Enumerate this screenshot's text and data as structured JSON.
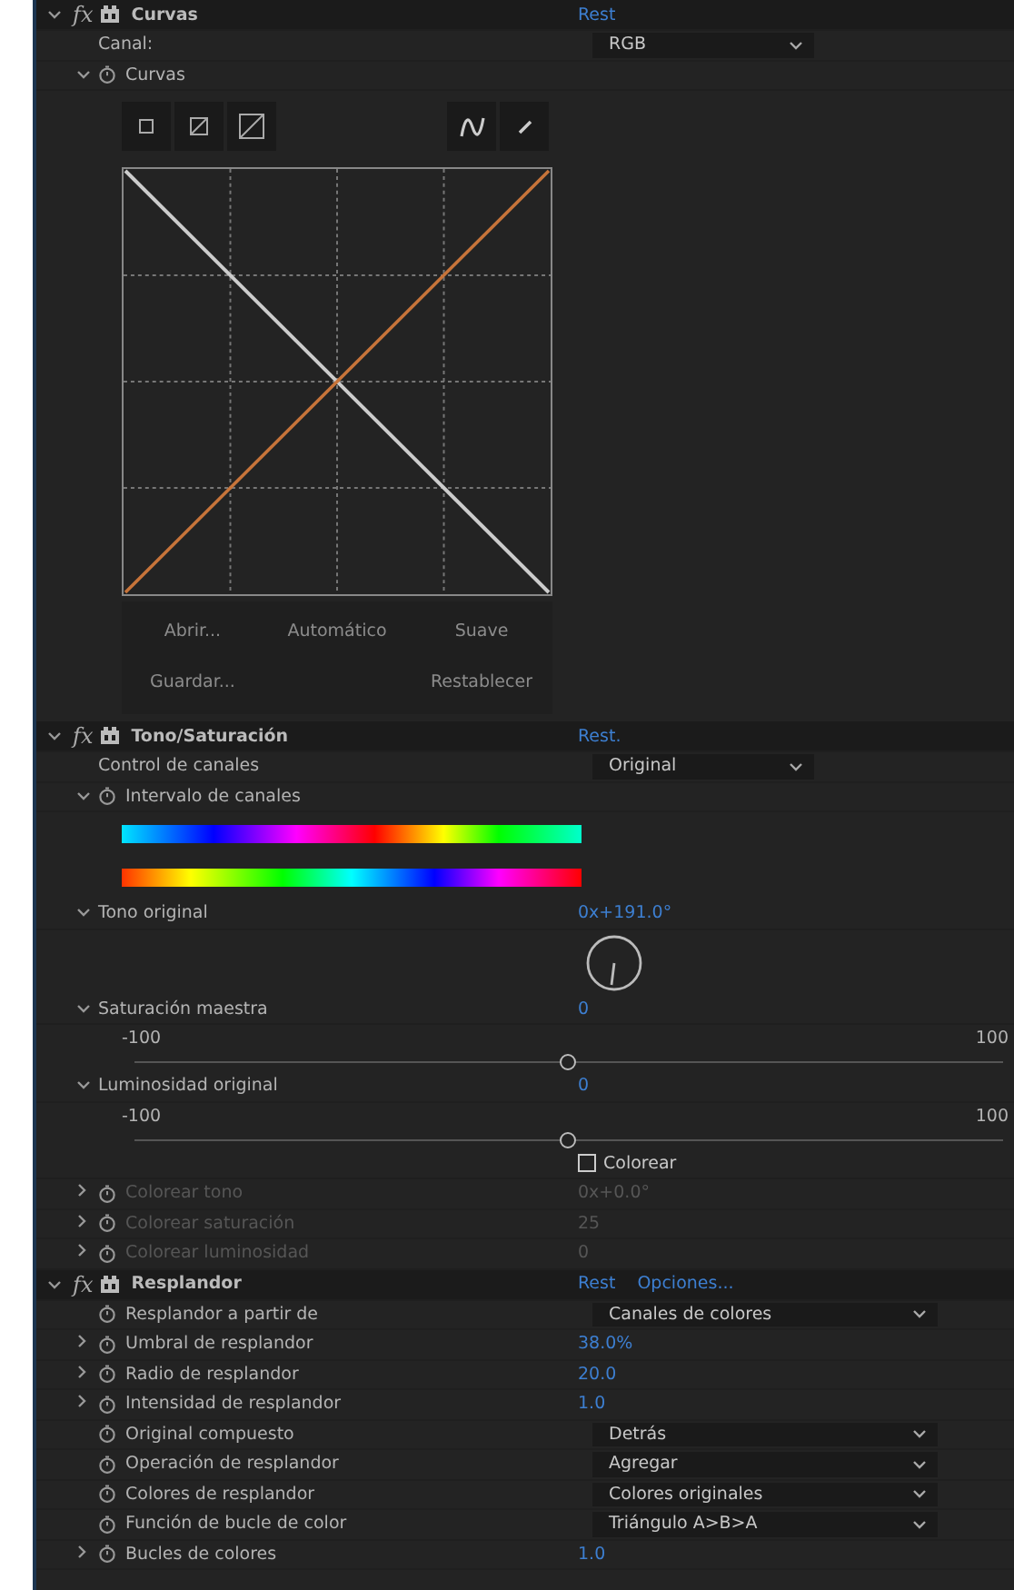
{
  "effects": [
    {
      "badge": "fx",
      "name": "Curvas",
      "expanded": true,
      "links": [
        "Rest"
      ],
      "rows": [
        {
          "kind": "dropdown",
          "label": "Canal:",
          "value": "RGB",
          "disabled": false
        },
        {
          "kind": "group",
          "label": "Curvas",
          "stopwatch": true,
          "expanded": true,
          "disabled": false
        },
        {
          "kind": "curves",
          "tools": [
            {
              "kind": "small"
            },
            {
              "kind": "medium"
            },
            {
              "kind": "large"
            },
            {
              "kind": "curve"
            },
            {
              "kind": "pencil"
            }
          ],
          "buttons": [
            {
              "items": [
                "Abrir...",
                "Automático",
                "Suave"
              ]
            },
            {
              "items": [
                "Guardar...",
                "Restablecer"
              ]
            }
          ]
        }
      ]
    },
    {
      "badge": "fx",
      "name": "Tono/Saturación",
      "expanded": true,
      "links": [
        "Rest."
      ],
      "rows": [
        {
          "kind": "dropdown",
          "label": "Control de canales",
          "value": "Original",
          "disabled": false
        },
        {
          "kind": "group",
          "label": "Intervalo de canales",
          "stopwatch": true,
          "expanded": true,
          "disabled": false
        },
        {
          "kind": "gradients"
        },
        {
          "kind": "number",
          "label": "Tono original",
          "value": "0x+191.0°",
          "expanded": true,
          "disabled": false
        },
        {
          "kind": "dial"
        },
        {
          "kind": "number",
          "label": "Saturación maestra",
          "value": "0",
          "expanded": true,
          "disabled": false
        },
        {
          "kind": "slider",
          "min": "-100",
          "max": "100",
          "level": 0.5
        },
        {
          "kind": "number",
          "label": "Luminosidad original",
          "value": "0",
          "expanded": true,
          "disabled": false
        },
        {
          "kind": "slider",
          "min": "-100",
          "max": "100",
          "level": 0.5
        },
        {
          "kind": "checkbox",
          "label": "Colorear",
          "checked": false
        },
        {
          "kind": "number",
          "label": "Colorear tono",
          "value": "0x+0.0°",
          "stopwatch": true,
          "expanded": false,
          "disabled": true
        },
        {
          "kind": "number",
          "label": "Colorear saturación",
          "value": "25",
          "stopwatch": true,
          "expanded": false,
          "disabled": true
        },
        {
          "kind": "number",
          "label": "Colorear luminosidad",
          "value": "0",
          "stopwatch": true,
          "expanded": false,
          "disabled": true
        }
      ]
    },
    {
      "badge": "fx",
      "name": "Resplandor",
      "expanded": true,
      "links": [
        "Rest",
        "Opciones..."
      ],
      "rows": [
        {
          "kind": "dropdown",
          "label": "Resplandor a partir de",
          "value": "Canales de colores",
          "stopwatch": true,
          "disabled": false
        },
        {
          "kind": "number",
          "label": "Umbral de resplandor",
          "value": "38.0%",
          "stopwatch": true,
          "expanded": false,
          "disabled": false
        },
        {
          "kind": "number",
          "label": "Radio de resplandor",
          "value": "20.0",
          "stopwatch": true,
          "expanded": false,
          "disabled": false
        },
        {
          "kind": "number",
          "label": "Intensidad de resplandor",
          "value": "1.0",
          "stopwatch": true,
          "expanded": false,
          "disabled": false
        },
        {
          "kind": "dropdown",
          "label": "Original compuesto",
          "value": "Detrás",
          "stopwatch": true,
          "disabled": false
        },
        {
          "kind": "dropdown",
          "label": "Operación de resplandor",
          "value": "Agregar",
          "stopwatch": true,
          "disabled": false
        },
        {
          "kind": "dropdown",
          "label": "Colores de resplandor",
          "value": "Colores originales",
          "stopwatch": true,
          "disabled": false
        },
        {
          "kind": "dropdown",
          "label": "Función de bucle de color",
          "value": "Triángulo A>B>A",
          "stopwatch": true,
          "disabled": false
        },
        {
          "kind": "number",
          "label": "Bucles de colores",
          "value": "1.0",
          "stopwatch": true,
          "expanded": false,
          "disabled": false
        }
      ]
    }
  ]
}
